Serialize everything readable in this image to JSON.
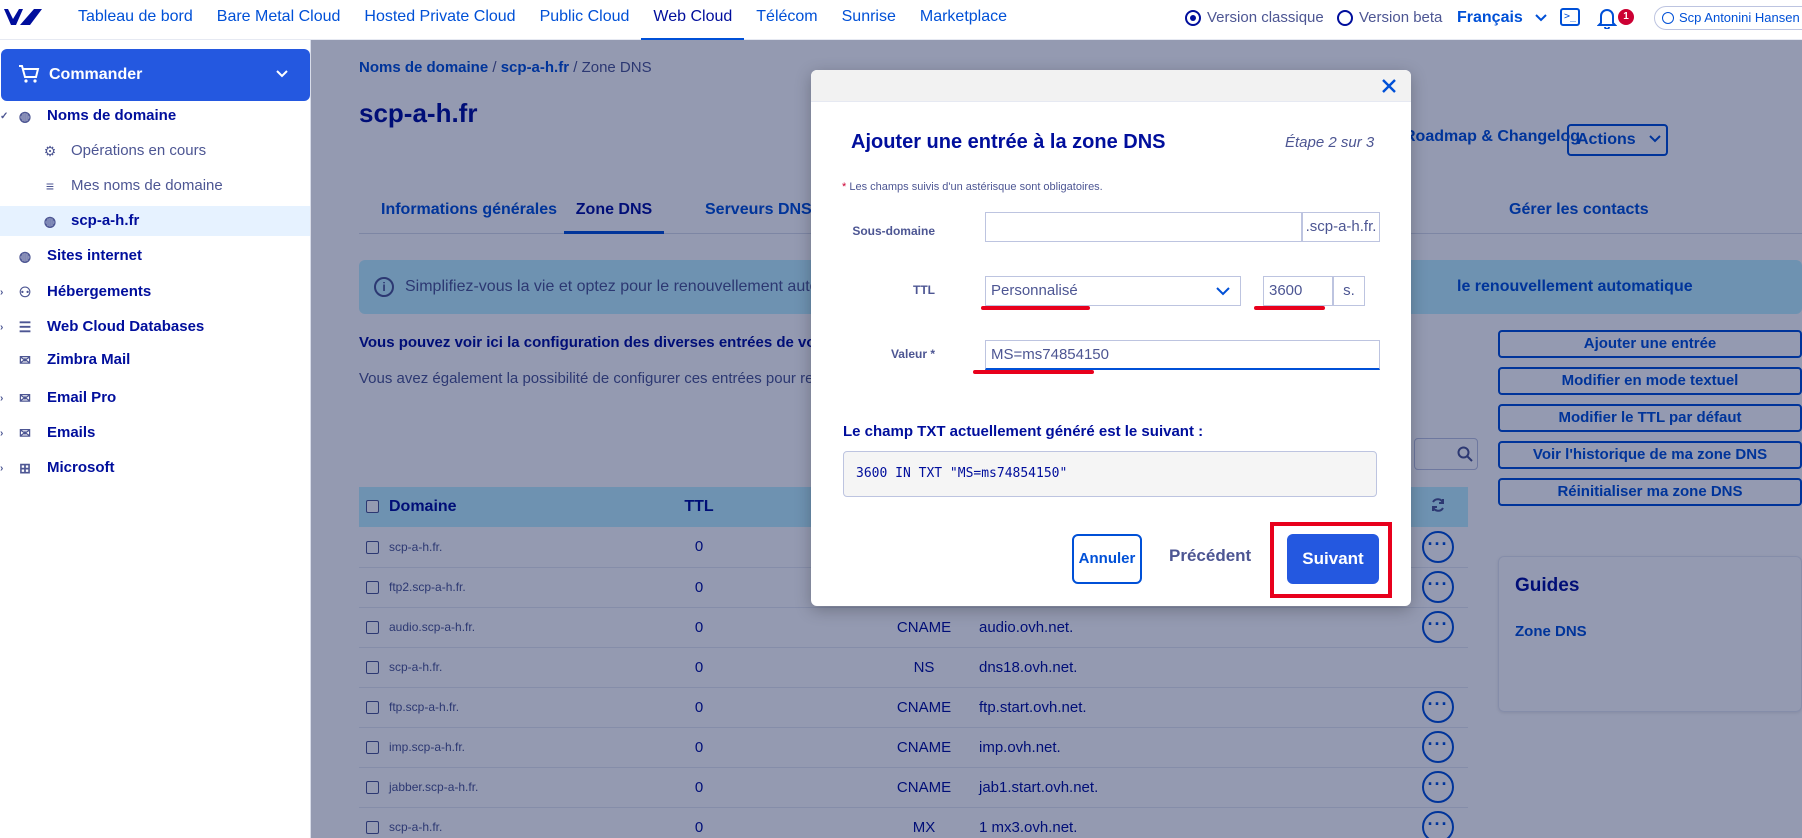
{
  "topnav": {
    "items": [
      "Tableau de bord",
      "Bare Metal Cloud",
      "Hosted Private Cloud",
      "Public Cloud",
      "Web Cloud",
      "Télécom",
      "Sunrise",
      "Marketplace"
    ],
    "active": "Web Cloud",
    "version_classic": "Version classique",
    "version_beta": "Version beta",
    "language": "Français",
    "notification_count": "1",
    "user": "Scp Antonini Hansen",
    "accent_color": "#0050d7"
  },
  "sidebar": {
    "order_label": "Commander",
    "items": [
      {
        "label": "Noms de domaine",
        "icon": "globe-icon"
      },
      {
        "label": "Opérations en cours",
        "icon": "gear-icon"
      },
      {
        "label": "Mes noms de domaine",
        "icon": "list-icon"
      },
      {
        "label": "scp-a-h.fr",
        "icon": "globe-icon"
      },
      {
        "label": "Sites internet",
        "icon": "globe-icon"
      },
      {
        "label": "Hébergements",
        "icon": "users-icon"
      },
      {
        "label": "Web Cloud Databases",
        "icon": "database-icon"
      },
      {
        "label": "Zimbra Mail",
        "icon": "mail-icon"
      },
      {
        "label": "Email Pro",
        "icon": "mail-icon"
      },
      {
        "label": "Emails",
        "icon": "mail-icon"
      },
      {
        "label": "Microsoft",
        "icon": "windows-icon"
      }
    ]
  },
  "main": {
    "breadcrumb": [
      "Noms de domaine",
      "scp-a-h.fr",
      "Zone DNS"
    ],
    "title": "scp-a-h.fr",
    "roadmap": "Roadmap & Changelog",
    "actions": "Actions",
    "tabs": [
      "Informations générales",
      "Zone DNS",
      "Serveurs DNS",
      "Gérer les contacts"
    ],
    "banner_left": "Simplifiez-vous la vie et optez pour le renouvellement automatique",
    "banner_right": "le renouvellement automatique",
    "desc1": "Vous pouvez voir ici la configuration des diverses entrées de votre zone DNS.",
    "desc2": "Vous avez également la possibilité de configurer ces entrées pour rediriger vos sous-domaines.",
    "side_buttons": [
      "Ajouter une entrée",
      "Modifier en mode textuel",
      "Modifier le TTL par défaut",
      "Voir l'historique de ma zone DNS",
      "Réinitialiser ma zone DNS"
    ],
    "guides_title": "Guides",
    "guides_link": "Zone DNS",
    "table": {
      "headers": [
        "Domaine",
        "TTL"
      ],
      "rows": [
        {
          "domain": "scp-a-h.fr.",
          "ttl": "0",
          "type": "",
          "target": "",
          "more": true
        },
        {
          "domain": "ftp2.scp-a-h.fr.",
          "ttl": "0",
          "type": "",
          "target": "",
          "more": true
        },
        {
          "domain": "audio.scp-a-h.fr.",
          "ttl": "0",
          "type": "CNAME",
          "target": "audio.ovh.net.",
          "more": true
        },
        {
          "domain": "scp-a-h.fr.",
          "ttl": "0",
          "type": "NS",
          "target": "dns18.ovh.net.",
          "more": false
        },
        {
          "domain": "ftp.scp-a-h.fr.",
          "ttl": "0",
          "type": "CNAME",
          "target": "ftp.start.ovh.net.",
          "more": true
        },
        {
          "domain": "imp.scp-a-h.fr.",
          "ttl": "0",
          "type": "CNAME",
          "target": "imp.ovh.net.",
          "more": true
        },
        {
          "domain": "jabber.scp-a-h.fr.",
          "ttl": "0",
          "type": "CNAME",
          "target": "jab1.start.ovh.net.",
          "more": true
        },
        {
          "domain": "scp-a-h.fr.",
          "ttl": "0",
          "type": "MX",
          "target": "1 mx3.ovh.net.",
          "more": true
        }
      ]
    }
  },
  "modal": {
    "title": "Ajouter une entrée à la zone DNS",
    "step": "Étape 2 sur 3",
    "required_star": "*",
    "required_note": " Les champs suivis d'un astérisque sont obligatoires.",
    "subdomain_label": "Sous-domaine",
    "subdomain_value": "",
    "subdomain_suffix": ".scp-a-h.fr.",
    "ttl_label": "TTL",
    "ttl_select": "Personnalisé",
    "ttl_value": "3600",
    "ttl_unit": "s.",
    "value_label": "Valeur *",
    "value_value": "MS=ms74854150",
    "txt_title": "Le champ TXT actuellement généré est le suivant :",
    "txt_value": "3600 IN TXT \"MS=ms74854150\"",
    "cancel": "Annuler",
    "previous": "Précédent",
    "next": "Suivant",
    "highlight_color": "#e8001c"
  }
}
